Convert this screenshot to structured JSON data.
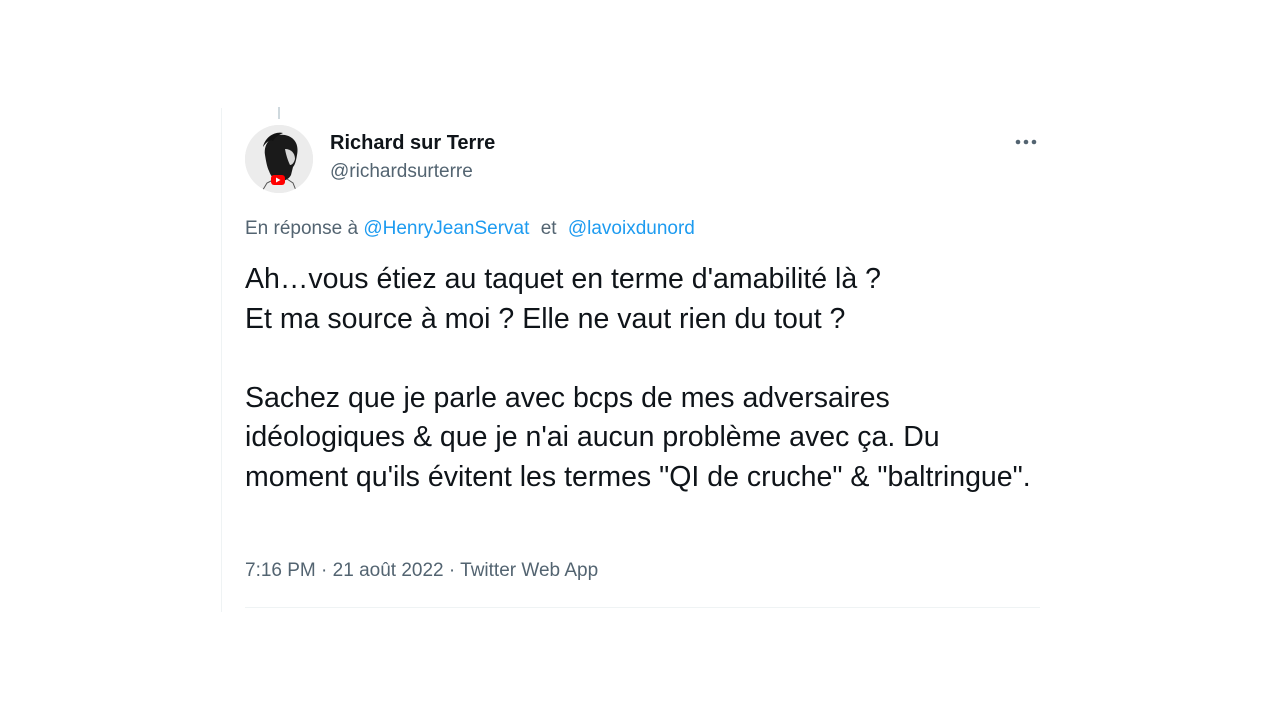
{
  "tweet": {
    "author": {
      "display_name": "Richard sur Terre",
      "handle": "@richardsurterre",
      "avatar_icon": "bearded-man-profile-avatar"
    },
    "more_icon": "more-dots-icon",
    "reply_to": {
      "prefix": "En réponse à",
      "mentions": [
        "@HenryJeanServat",
        "@lavoixdunord"
      ],
      "separator": "et"
    },
    "text": "Ah…vous étiez au taquet en terme d'amabilité là ?\nEt ma source à moi ? Elle ne vaut rien du tout ?\n\nSachez que je parle avec bcps de mes adversaires idéologiques & que je n'ai aucun problème avec ça. Du moment qu'ils évitent les termes \"QI de cruche\" & \"baltringue\".",
    "meta": {
      "time": "7:16 PM",
      "dot": "·",
      "date": "21 août 2022",
      "source": "Twitter Web App"
    },
    "colors": {
      "text": "#0f1419",
      "secondary": "#536471",
      "accent": "#1d9bf0",
      "border": "#eff3f4"
    }
  }
}
